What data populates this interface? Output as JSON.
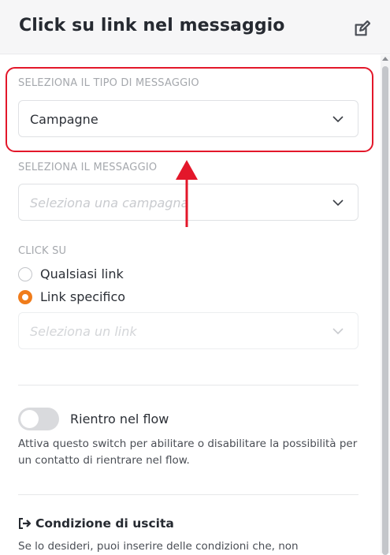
{
  "header": {
    "title": "Click su link nel messaggio",
    "edit_icon": "edit-icon"
  },
  "message_type": {
    "label": "SELEZIONA IL TIPO DI MESSAGGIO",
    "selected": "Campagne"
  },
  "message": {
    "label": "SELEZIONA IL MESSAGGIO",
    "placeholder": "Seleziona una campagna"
  },
  "click": {
    "label": "CLICK SU",
    "options": [
      {
        "label": "Qualsiasi link",
        "checked": false
      },
      {
        "label": "Link specifico",
        "checked": true
      }
    ],
    "link_placeholder": "Seleziona un link"
  },
  "reentry": {
    "label": "Rientro nel flow",
    "enabled": false,
    "help": "Attiva questo switch per abilitare o disabilitare la possibilità per un contatto di rientrare nel flow."
  },
  "exit": {
    "title": "Condizione di uscita",
    "icon": "sign-out-icon",
    "text": "Se lo desideri, puoi inserire delle condizioni che, non"
  },
  "annotation": {
    "highlight_color": "#e3172a",
    "arrow": "up-arrow"
  },
  "colors": {
    "accent": "#f07c1b",
    "annotation": "#e3172a"
  }
}
